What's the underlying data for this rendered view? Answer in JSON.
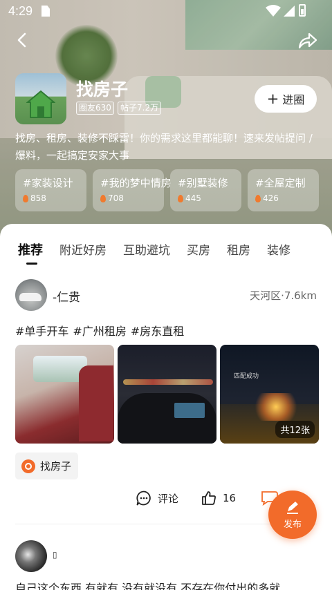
{
  "status_bar": {
    "time": "4:29"
  },
  "group": {
    "name": "找房子",
    "members_chip": "圈友630",
    "posts_chip": "帖子7.2万",
    "join_label": "进圈",
    "description": "找房、租房、装修不踩雷！你的需求这里都能聊！速来发帖提问 / 爆料，一起搞定安家大事"
  },
  "topics": [
    {
      "name": "#家装设计",
      "count": "858"
    },
    {
      "name": "#我的梦中情房",
      "count": "708"
    },
    {
      "name": "#别墅装修",
      "count": "445"
    },
    {
      "name": "#全屋定制",
      "count": "426"
    }
  ],
  "tabs": [
    {
      "label": "推荐",
      "active": true
    },
    {
      "label": "附近好房"
    },
    {
      "label": "互助避坑"
    },
    {
      "label": "买房"
    },
    {
      "label": "租房"
    },
    {
      "label": "装修"
    }
  ],
  "post": {
    "user": "-仁贵",
    "location": "天河区·7.6km",
    "tags": [
      "#单手开车",
      "#广州租房",
      "#房东直租"
    ],
    "photo_count": "共12张",
    "photo_overlay_text": "匹配成功",
    "group_tag": "找房子",
    "comment_label": "评论",
    "like_count": "16"
  },
  "post2": {
    "user": "▯",
    "text": "自己这个东西,有就有,没有就没有,不存在你付出的多就"
  },
  "publish_label": "发布",
  "colors": {
    "accent": "#f26b2a"
  },
  "icons": [
    "back-icon",
    "share-icon",
    "plus-icon",
    "fire-icon",
    "comment-icon",
    "like-icon",
    "edit-icon",
    "group-logo-icon"
  ]
}
